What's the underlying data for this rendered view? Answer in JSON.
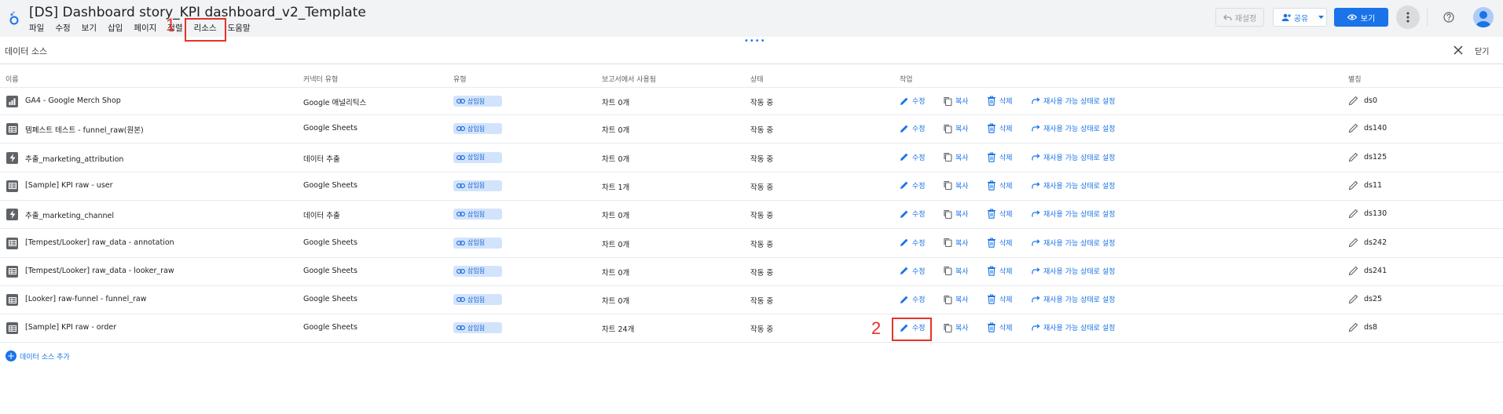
{
  "header": {
    "title": "[DS] Dashboard story_KPI dashboard_v2_Template",
    "menu": [
      "파일",
      "수정",
      "보기",
      "삽입",
      "페이지",
      "정렬",
      "리소스",
      "도움말"
    ],
    "reset_label": "재설정",
    "share_label": "공유",
    "view_label": "보기"
  },
  "annotations": [
    "1",
    "2"
  ],
  "panel": {
    "title": "데이터 소스",
    "close_label": "닫기"
  },
  "table": {
    "columns": [
      "이름",
      "커넥터 유형",
      "유형",
      "보고서에서 사용됨",
      "상태",
      "작업",
      "별칭"
    ],
    "actions": {
      "edit": "수정",
      "copy": "복사",
      "delete": "삭제",
      "reusable": "재사용 가능 상태로 설정"
    },
    "rows": [
      {
        "icon": "analytics",
        "name": "GA4 - Google Merch Shop",
        "connector": "Google 애널리틱스",
        "type": "삽입됨",
        "used": "차트 0개",
        "status": "작동 중",
        "alias": "ds0"
      },
      {
        "icon": "sheet",
        "name": "템페스트 테스트 - funnel_raw(원본)",
        "connector": "Google Sheets",
        "type": "삽입됨",
        "used": "차트 0개",
        "status": "작동 중",
        "alias": "ds140"
      },
      {
        "icon": "extract",
        "name": "추출_marketing_attribution",
        "connector": "데이터 추출",
        "type": "삽입됨",
        "used": "차트 0개",
        "status": "작동 중",
        "alias": "ds125"
      },
      {
        "icon": "sheet",
        "name": "[Sample] KPI raw - user",
        "connector": "Google Sheets",
        "type": "삽입됨",
        "used": "차트 1개",
        "status": "작동 중",
        "alias": "ds11"
      },
      {
        "icon": "extract",
        "name": "추출_marketing_channel",
        "connector": "데이터 추출",
        "type": "삽입됨",
        "used": "차트 0개",
        "status": "작동 중",
        "alias": "ds130"
      },
      {
        "icon": "sheet",
        "name": "[Tempest/Looker] raw_data - annotation",
        "connector": "Google Sheets",
        "type": "삽입됨",
        "used": "차트 0개",
        "status": "작동 중",
        "alias": "ds242"
      },
      {
        "icon": "sheet",
        "name": "[Tempest/Looker] raw_data - looker_raw",
        "connector": "Google Sheets",
        "type": "삽입됨",
        "used": "차트 0개",
        "status": "작동 중",
        "alias": "ds241"
      },
      {
        "icon": "sheet",
        "name": "[Looker] raw-funnel - funnel_raw",
        "connector": "Google Sheets",
        "type": "삽입됨",
        "used": "차트 0개",
        "status": "작동 중",
        "alias": "ds25"
      },
      {
        "icon": "sheet",
        "name": "[Sample] KPI raw - order",
        "connector": "Google Sheets",
        "type": "삽입됨",
        "used": "차트 24개",
        "status": "작동 중",
        "alias": "ds8"
      }
    ],
    "add_label": "데이터 소스 추가"
  },
  "colors": {
    "accent": "#1a73e8",
    "annotation": "#e8302a",
    "badge_bg": "#d2e3fc"
  }
}
